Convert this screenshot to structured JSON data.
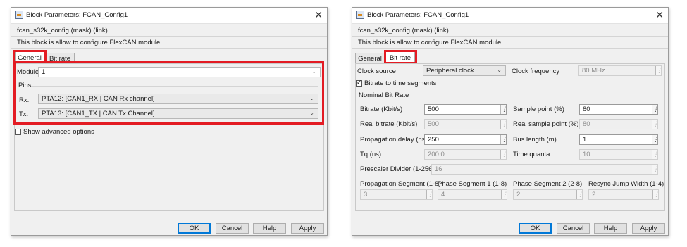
{
  "left": {
    "title": "Block Parameters: FCAN_Config1",
    "block_name": "fcan_s32k_config (mask) (link)",
    "description": "This block is allow to configure FlexCAN module.",
    "tabs": [
      {
        "label": "General",
        "active": true
      },
      {
        "label": "Bit rate",
        "active": false
      }
    ],
    "module_label": "Module",
    "module_value": "1",
    "pins_label": "Pins",
    "rx_label": "Rx:",
    "rx_value": "PTA12: [CAN1_RX | CAN Rx channel]",
    "tx_label": "Tx:",
    "tx_value": "PTA13: [CAN1_TX | CAN Tx Channel]",
    "show_advanced_label": "Show advanced options",
    "show_advanced_checked": false
  },
  "right": {
    "title": "Block Parameters: FCAN_Config1",
    "block_name": "fcan_s32k_config (mask) (link)",
    "description": "This block is allow to configure FlexCAN module.",
    "tabs": [
      {
        "label": "General",
        "active": false
      },
      {
        "label": "Bit rate",
        "active": true
      }
    ],
    "clock_source_label": "Clock source",
    "clock_source_value": "Peripheral clock",
    "clock_frequency_label": "Clock frequency",
    "clock_frequency_value": "80 MHz",
    "bitrate_to_time_label": "Bitrate to time segments",
    "bitrate_to_time_checked": true,
    "nominal_label": "Nominal Bit Rate",
    "bitrate_label": "Bitrate (Kbit/s)",
    "bitrate_value": "500",
    "sample_point_label": "Sample point (%)",
    "sample_point_value": "80",
    "real_bitrate_label": "Real bitrate (Kbit/s)",
    "real_bitrate_value": "500",
    "real_sample_label": "Real sample point (%)",
    "real_sample_value": "80",
    "prop_delay_label": "Propagation delay (ns)",
    "prop_delay_value": "250",
    "bus_length_label": "Bus length (m)",
    "bus_length_value": "1",
    "tq_label": "Tq (ns)",
    "tq_value": "200.0",
    "time_quanta_label": "Time quanta",
    "time_quanta_value": "10",
    "prescaler_label": "Prescaler Divider (1-256)",
    "prescaler_value": "16",
    "prop_seg_label": "Propagation Segment (1-8)",
    "prop_seg_value": "3",
    "phase1_label": "Phase Segment 1 (1-8)",
    "phase1_value": "4",
    "phase2_label": "Phase Segment 2 (2-8)",
    "phase2_value": "2",
    "sjw_label": "Resync Jump Width (1-4)",
    "sjw_value": "2"
  },
  "buttons": {
    "ok": "OK",
    "cancel": "Cancel",
    "help": "Help",
    "apply": "Apply"
  },
  "icons": {
    "close": "close-icon",
    "dropdown": "chevron-down-icon",
    "ellipsis": "ellipsis-vertical-icon"
  },
  "colors": {
    "highlight": "#e31b23",
    "default_button": "#0078d7"
  }
}
